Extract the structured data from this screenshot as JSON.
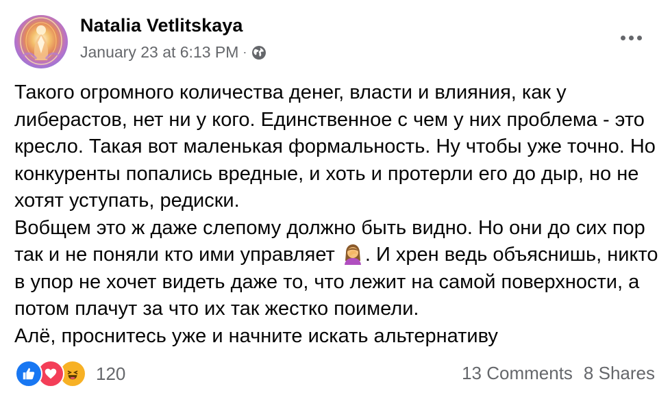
{
  "post": {
    "author": "Natalia Vetlitskaya",
    "timestamp": "January 23 at 6:13 PM",
    "separator": "·",
    "privacy_icon": "globe-icon",
    "more_icon": "more-options-icon",
    "text_p1": "Такого огромного количества денег, власти и влияния, как у либерастов, нет ни у кого. Единственное с чем у них проблема - это кресло. Такая вот маленькая формальность. Ну чтобы уже точно. Но конкуренты попались вредные, и хоть и протерли его до дыр, но не хотят уступать, редиски.",
    "text_p2_a": "Вобщем это ж даже слепому должно быть видно. Но они до сих пор так и не поняли кто ими управляет ",
    "text_p2_emoji": "woman-facepalming-emoji",
    "text_p2_b": ". И хрен ведь объяснишь, никто в упор не хочет видеть даже то, что лежит на самой поверхности, а потом плачут за что их так жестко поимели.",
    "text_p3": "Алё, проснитесь уже и начните искать альтернативу"
  },
  "footer": {
    "reactions": [
      "like-reaction-icon",
      "love-reaction-icon",
      "haha-reaction-icon"
    ],
    "reaction_count": "120",
    "comments": "13 Comments",
    "shares": "8 Shares"
  },
  "colors": {
    "text": "#050505",
    "secondary": "#65676b",
    "like": "#1877f2",
    "love": "#f33e58",
    "haha": "#f7b125"
  }
}
